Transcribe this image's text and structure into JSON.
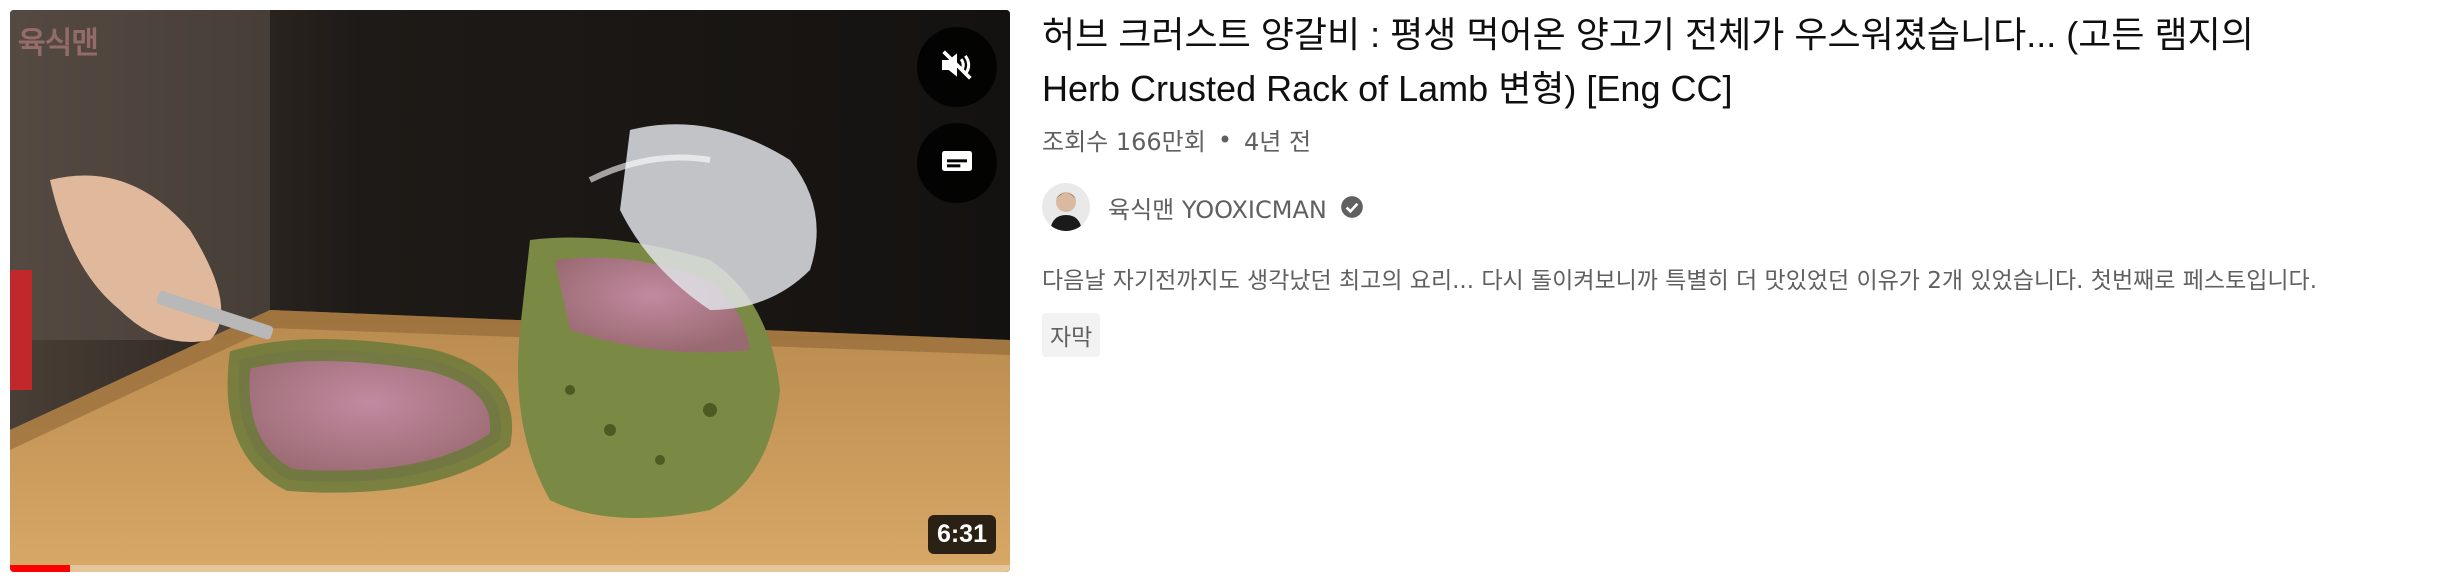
{
  "video": {
    "title_line1": "허브 크러스트 양갈비 : 평생 먹어온 양고기 전체가 우스워졌습니다... (고든 램지의",
    "title_line2": "Herb Crusted Rack of Lamb 변형) [Eng CC]",
    "views": "조회수 166만회",
    "separator": "•",
    "age": "4년 전",
    "duration": "6:31",
    "watch_progress": 0.06,
    "description": "다음날 자기전까지도 생각났던 최고의 요리... 다시 돌이켜보니까 특별히 더 맛있었던 이유가 2개 있었습니다. 첫번째로 페스토입니다.",
    "badge": "자막"
  },
  "thumbnail": {
    "watermark": "육식맨",
    "mute_icon": "muted-speaker-icon",
    "captions_icon": "captions-icon"
  },
  "channel": {
    "name": "육식맨 YOOXICMAN",
    "verified_icon": "verified-check-icon",
    "avatar_icon": "channel-avatar"
  },
  "colors": {
    "progress": "#ff0000",
    "overlay": "#000000",
    "meta_text": "#606060",
    "title_text": "#0f0f0f"
  }
}
